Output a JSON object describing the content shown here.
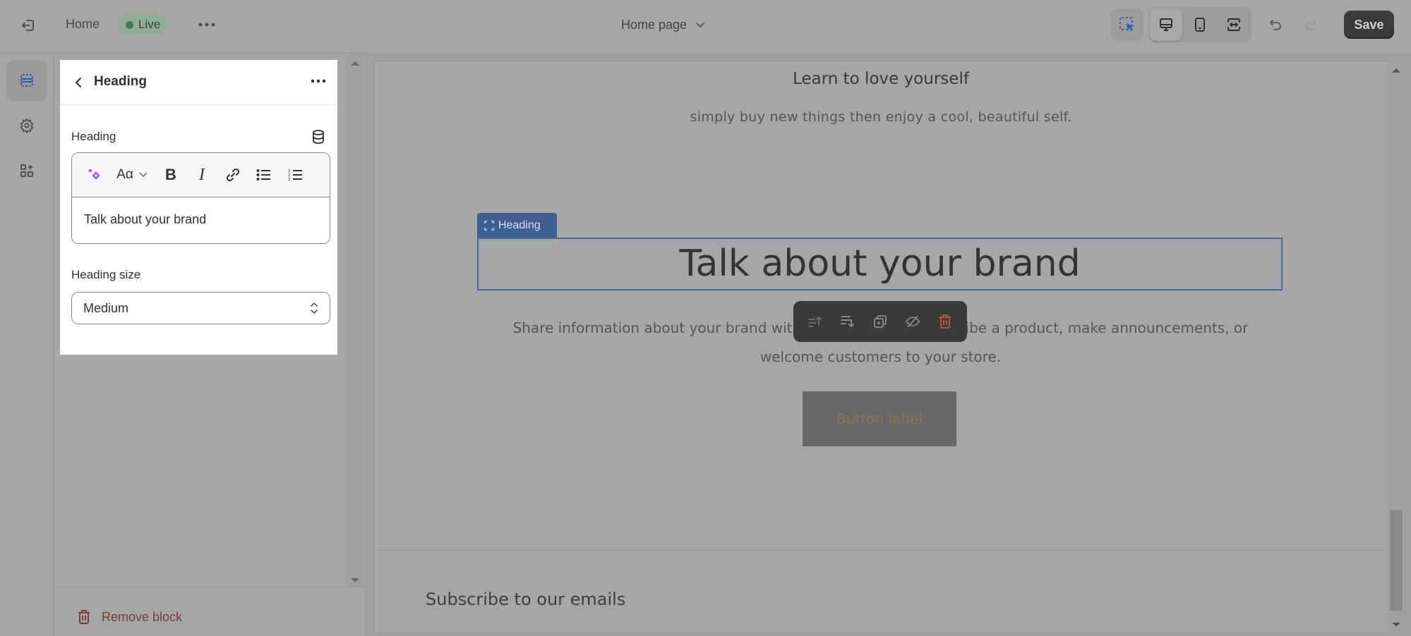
{
  "topbar": {
    "home_label": "Home",
    "status_badge": "Live",
    "page_selector": "Home page",
    "save_label": "Save",
    "status_color": "#3f7a54",
    "accent_color": "#2c6ecb"
  },
  "rail": {
    "items": [
      {
        "name": "sections",
        "active": true
      },
      {
        "name": "theme-settings",
        "active": false
      },
      {
        "name": "apps",
        "active": false
      }
    ]
  },
  "panel": {
    "title": "Heading",
    "heading_field_label": "Heading",
    "heading_value": "Talk about your brand",
    "heading_size_label": "Heading size",
    "heading_size_value": "Medium",
    "toolbar": [
      "ai-sparkle",
      "font-style",
      "bold",
      "italic",
      "link",
      "bullet-list",
      "numbered-list"
    ],
    "remove_label": "Remove block"
  },
  "preview": {
    "section1_heading": "Learn to love yourself",
    "section1_text": "simply buy new things then enjoy a cool, beautiful self.",
    "selected_tag": "Heading",
    "heading": "Talk about your brand",
    "body": "Share information about your brand with your customers. Describe a product, make announcements, or welcome customers to your store.",
    "button_label": "Button label",
    "subscribe_heading": "Subscribe to our emails",
    "floating_toolbar": [
      "move-up",
      "move-down",
      "duplicate",
      "hide",
      "delete"
    ]
  }
}
